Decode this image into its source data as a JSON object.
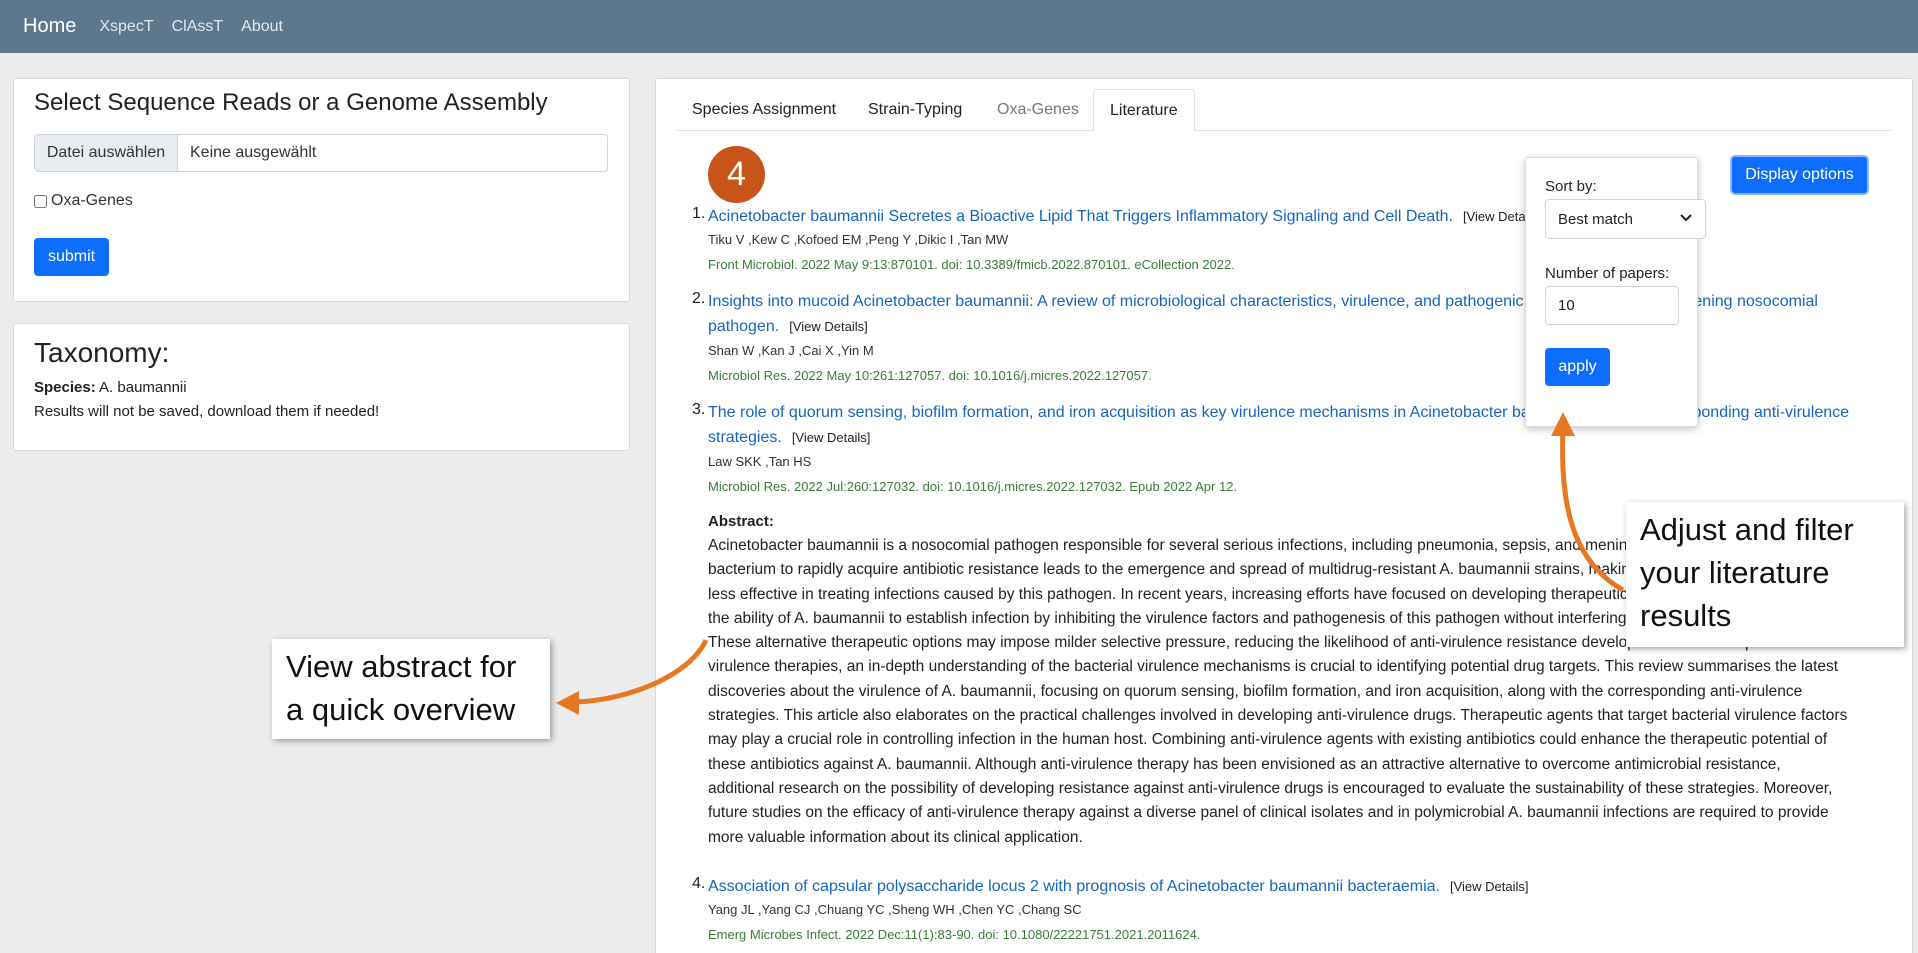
{
  "navbar": {
    "brand": "Home",
    "links": [
      "XspecT",
      "ClAssT",
      "About"
    ]
  },
  "select_card": {
    "title": "Select Sequence Reads or a Genome Assembly",
    "file_button": "Datei auswählen",
    "file_status": "Keine ausgewählt",
    "oxa_label": "Oxa-Genes",
    "submit_label": "submit"
  },
  "taxonomy_card": {
    "title": "Taxonomy:",
    "species_label": "Species:",
    "species_value": "A. baumannii",
    "results_note": "Results will not be saved, download them if needed!"
  },
  "tabs": [
    "Species Assignment",
    "Strain-Typing",
    "Oxa-Genes",
    "Literature"
  ],
  "step_badge": "4",
  "display_options": {
    "button_label": "Display options",
    "sort_label": "Sort by:",
    "sort_value": "Best match",
    "num_label": "Number of papers:",
    "num_value": "10",
    "apply_label": "apply"
  },
  "view_details": "[View Details]",
  "papers": [
    {
      "num": "1.",
      "title_line1": "Acinetobacter baumannii Secretes a Bioactive Lipid That Triggers Inflammatory Signaling and Cell Death.",
      "title_line2": "",
      "authors": "Tiku V ,Kew C ,Kofoed EM ,Peng Y ,Dikic I ,Tan MW",
      "journal": "Front Microbiol. 2022 May 9:13:870101. doi: 10.3389/fmicb.2022.870101. eCollection 2022."
    },
    {
      "num": "2.",
      "title_line1": "Insights into mucoid Acinetobacter baumannii: A review of microbiological characteristics, virulence, and pathogenic mechanisms in a threatening nosocomial",
      "title_line2": "pathogen.",
      "authors": "Shan W ,Kan J ,Cai X ,Yin M",
      "journal": "Microbiol Res. 2022 May 10:261:127057. doi: 10.1016/j.micres.2022.127057."
    },
    {
      "num": "3.",
      "title_line1": "The role of quorum sensing, biofilm formation, and iron acquisition as key virulence mechanisms in Acinetobacter baumannii and the corresponding anti-virulence",
      "title_line2": "strategies.",
      "authors": "Law SKK ,Tan HS",
      "journal": "Microbiol Res. 2022 Jul:260:127032. doi: 10.1016/j.micres.2022.127032. Epub 2022 Apr 12."
    },
    {
      "num": "4.",
      "title_line1": "Association of capsular polysaccharide locus 2 with prognosis of Acinetobacter baumannii bacteraemia.",
      "title_line2": "",
      "authors": "Yang JL ,Yang CJ ,Chuang YC ,Sheng WH ,Chen YC ,Chang SC",
      "journal": "Emerg Microbes Infect. 2022 Dec:11(1):83-90. doi: 10.1080/22221751.2021.2011624."
    }
  ],
  "abstract": {
    "heading": "Abstract:",
    "lines": [
      "Acinetobacter baumannii is a nosocomial pathogen responsible for several serious infections, including pneumonia, sepsis, and meningitis. The ability of this",
      "bacterium to rapidly acquire antibiotic resistance leads to the emergence and spread of multidrug-resistant A. baumannii strains, making existing antibiotics",
      "less effective in treating infections caused by this pathogen. In recent years, increasing efforts have focused on developing therapeutic strategies that reduce",
      "the ability of A. baumannii to establish infection by inhibiting the virulence factors and pathogenesis of this pathogen without interfering with its growth.",
      "These alternative therapeutic options may impose milder selective pressure, reducing the likelihood of anti-virulence resistance development. To develop novel anti-",
      "virulence therapies, an in-depth understanding of the bacterial virulence mechanisms is crucial to identifying potential drug targets. This review summarises the latest",
      "discoveries about the virulence of A. baumannii, focusing on quorum sensing, biofilm formation, and iron acquisition, along with the corresponding anti-virulence",
      "strategies. This article also elaborates on the practical challenges involved in developing anti-virulence drugs. Therapeutic agents that target bacterial virulence factors",
      "may play a crucial role in controlling infection in the human host. Combining anti-virulence agents with existing antibiotics could enhance the therapeutic potential of",
      "these antibiotics against A. baumannii. Although anti-virulence therapy has been envisioned as an attractive alternative to overcome antimicrobial resistance,",
      "additional research on the possibility of developing resistance against anti-virulence drugs is encouraged to evaluate the sustainability of these strategies. Moreover,",
      "future studies on the efficacy of anti-virulence therapy against a diverse panel of clinical isolates and in polymicrobial A. baumannii infections are required to provide",
      "more valuable information about its clinical application."
    ]
  },
  "callouts": {
    "right_lines": [
      "Adjust and filter",
      "your literature",
      "results"
    ],
    "left_lines": [
      "View abstract for",
      "a quick overview"
    ]
  },
  "colors": {
    "navbar": "#5d778c",
    "primary": "#0d6efd",
    "link": "#1565c0",
    "journal": "#3a7b3a",
    "badge": "#c8541a",
    "arrow": "#e87722"
  }
}
